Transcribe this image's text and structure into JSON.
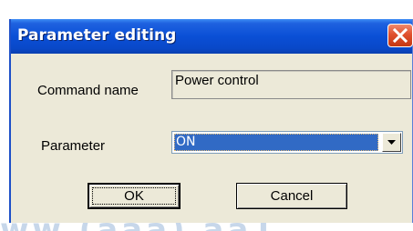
{
  "dialog": {
    "title": "Parameter editing",
    "command_name_label": "Command name",
    "command_name_value": "Power control",
    "parameter_label": "Parameter",
    "parameter_value": "ON",
    "ok_label": "OK",
    "cancel_label": "Cancel"
  },
  "icons": {
    "close": "close-icon",
    "dropdown": "chevron-down-icon"
  },
  "colors": {
    "titlebar": "#0a4fd6",
    "close_button": "#e0502e",
    "selection": "#316ac5",
    "dialog_face": "#ece9d8"
  }
}
